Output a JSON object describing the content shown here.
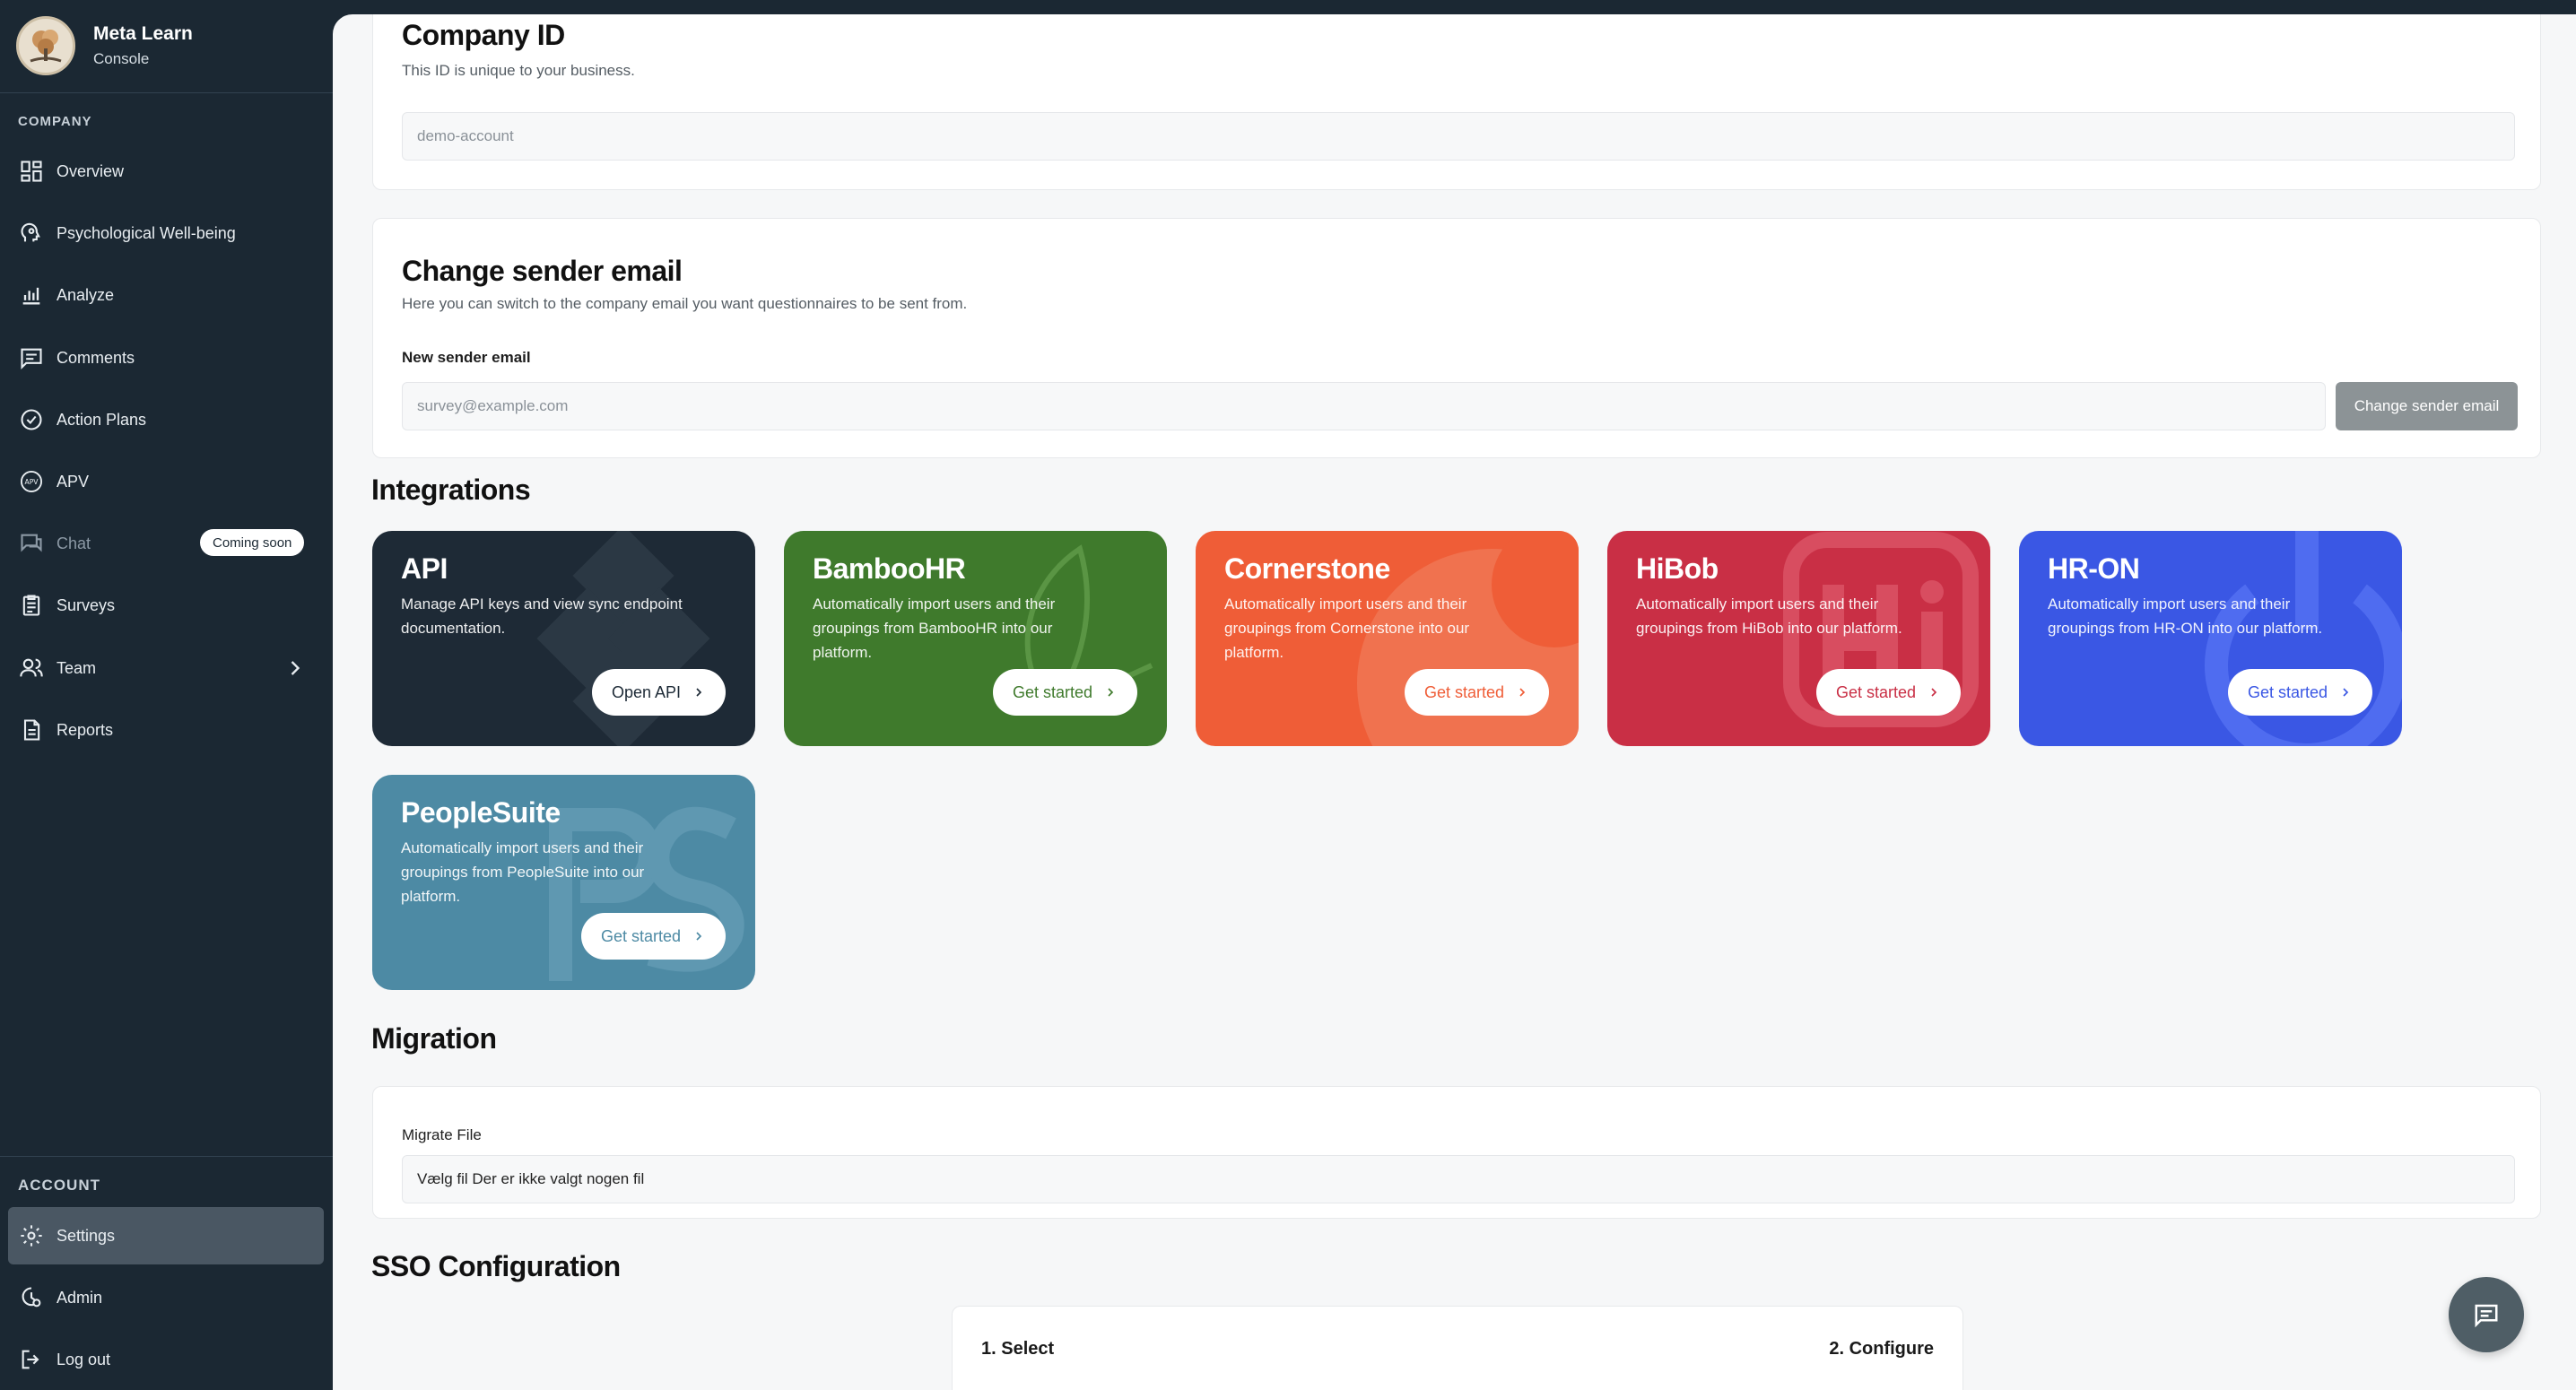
{
  "brand": {
    "name": "Meta Learn",
    "subtitle": "Console"
  },
  "sidebar": {
    "company_label": "COMPANY",
    "account_label": "ACCOUNT",
    "company_items": [
      {
        "label": "Overview",
        "icon": "dashboard-icon"
      },
      {
        "label": "Psychological Well-being",
        "icon": "head-icon"
      },
      {
        "label": "Analyze",
        "icon": "bar-chart-icon"
      },
      {
        "label": "Comments",
        "icon": "comment-icon"
      },
      {
        "label": "Action Plans",
        "icon": "check-circle-icon"
      },
      {
        "label": "APV",
        "icon": "apv-icon"
      },
      {
        "label": "Chat",
        "icon": "chat-icon",
        "badge": "Coming soon"
      },
      {
        "label": "Surveys",
        "icon": "clipboard-icon"
      },
      {
        "label": "Team",
        "icon": "team-icon"
      },
      {
        "label": "Reports",
        "icon": "report-icon"
      }
    ],
    "account_items": [
      {
        "label": "Settings",
        "icon": "gear-icon",
        "active": true
      },
      {
        "label": "Admin",
        "icon": "admin-icon"
      },
      {
        "label": "Log out",
        "icon": "logout-icon"
      }
    ]
  },
  "company_id": {
    "title": "Company ID",
    "subtitle": "This ID is unique to your business.",
    "value": "demo-account"
  },
  "sender_email": {
    "title": "Change sender email",
    "subtitle": "Here you can switch to the company email you want questionnaires to be sent from.",
    "field_label": "New sender email",
    "placeholder": "survey@example.com",
    "button": "Change sender email"
  },
  "integrations": {
    "heading": "Integrations",
    "tiles": [
      {
        "title": "API",
        "desc": "Manage API keys and view sync endpoint documentation.",
        "button": "Open API",
        "color": "#1e2a36"
      },
      {
        "title": "BambooHR",
        "desc": "Automatically import users and their groupings from BambooHR into our platform.",
        "button": "Get started",
        "color": "#3f7a2c"
      },
      {
        "title": "Cornerstone",
        "desc": "Automatically import users and their groupings from Cornerstone into our platform.",
        "button": "Get started",
        "color": "#ef5d37"
      },
      {
        "title": "HiBob",
        "desc": "Automatically import users and their groupings from HiBob into our platform.",
        "button": "Get started",
        "color": "#c92f45"
      },
      {
        "title": "HR-ON",
        "desc": "Automatically import users and their groupings from HR-ON into our platform.",
        "button": "Get started",
        "color": "#3a57e4"
      },
      {
        "title": "PeopleSuite",
        "desc": "Automatically import users and their groupings from PeopleSuite into our platform.",
        "button": "Get started",
        "color": "#4d8aa4"
      }
    ]
  },
  "migration": {
    "heading": "Migration",
    "field_label": "Migrate File",
    "file_text": "Vælg fil Der er ikke valgt nogen fil"
  },
  "sso": {
    "heading": "SSO Configuration",
    "step1": "1. Select",
    "step2": "2. Configure"
  }
}
